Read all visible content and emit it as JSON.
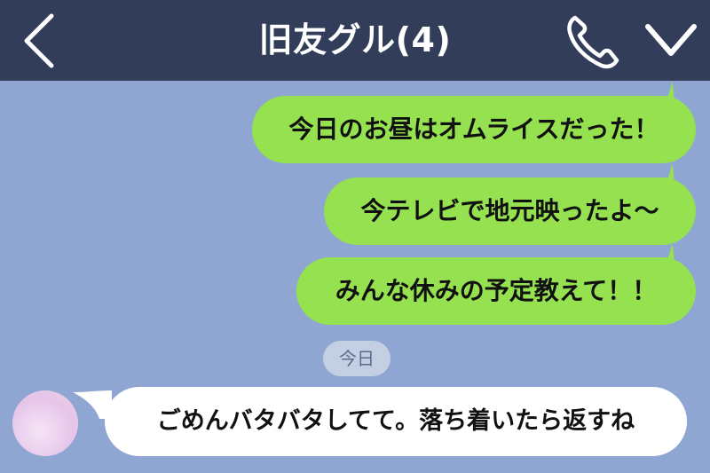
{
  "header": {
    "title": "旧友グル(4)",
    "back_icon": "chevron-left-icon",
    "call_icon": "phone-icon",
    "menu_icon": "chevron-down-icon"
  },
  "messages_sent": [
    {
      "text": "今日のお昼はオムライスだった！"
    },
    {
      "text": "今テレビで地元映ったよ～"
    },
    {
      "text": "みんな休みの予定教えて！！"
    }
  ],
  "date_separator": "今日",
  "message_received": {
    "text": "ごめんバタバタしてて。落ち着いたら返すね"
  },
  "colors": {
    "header_bg": "#323d59",
    "chat_bg": "#8fa6d2",
    "sent_bubble": "#95e14f",
    "received_bubble": "#ffffff"
  }
}
